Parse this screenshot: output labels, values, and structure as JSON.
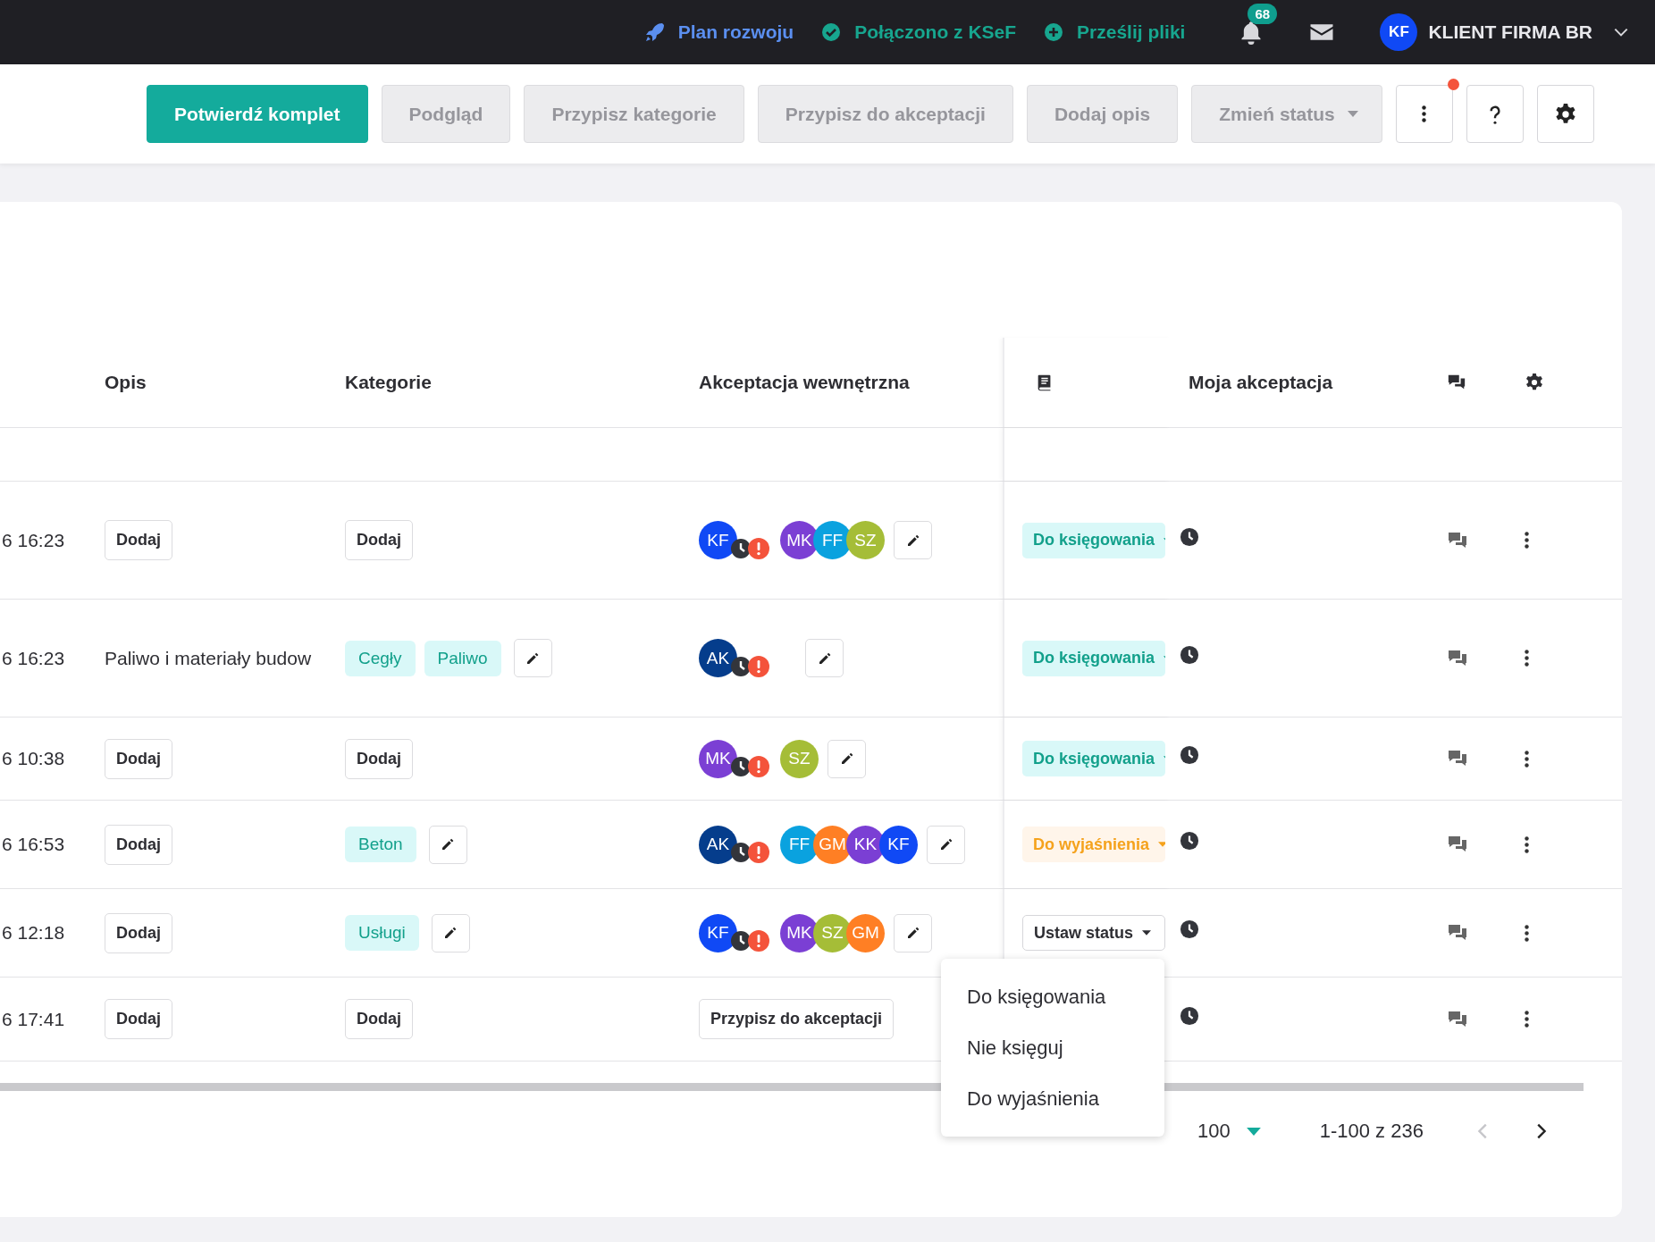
{
  "top_bar": {
    "links": [
      {
        "kind": "roadmap",
        "label": "Plan rozwoju"
      },
      {
        "kind": "connected",
        "label": "Połączono z KSeF"
      },
      {
        "kind": "upload",
        "label": "Prześlij pliki"
      }
    ],
    "notifications_count": "68",
    "user": {
      "initials": "KF",
      "name": "KLIENT FIRMA BR"
    }
  },
  "toolbar": {
    "buttons": [
      {
        "kind": "primary",
        "label": "Potwierdź komplet",
        "disabled": false
      },
      {
        "kind": "plain",
        "label": "Podgląd",
        "disabled": true
      },
      {
        "kind": "plain",
        "label": "Przypisz kategorie",
        "disabled": true
      },
      {
        "kind": "plain",
        "label": "Przypisz do akceptacji",
        "disabled": true
      },
      {
        "kind": "plain",
        "label": "Dodaj opis",
        "disabled": true
      },
      {
        "kind": "dropdown",
        "label": "Zmień status",
        "disabled": true
      }
    ],
    "more_has_alert": true
  },
  "table": {
    "columns": [
      "Opis",
      "Kategorie",
      "Akceptacja wewnętrzna",
      "Moja akceptacja"
    ],
    "rows": [
      {
        "date": "6 16:23",
        "description": {
          "kind": "add",
          "label": "Dodaj"
        },
        "categories": {
          "kind": "add",
          "label": "Dodaj"
        },
        "approval": {
          "kind": "avatars",
          "owner": {
            "initials": "KF",
            "color": "#1049f5"
          },
          "pending": true,
          "others": [
            {
              "initials": "MK",
              "color": "#7b3fd4"
            },
            {
              "initials": "FF",
              "color": "#0aa2df"
            },
            {
              "initials": "SZ",
              "color": "#a5bd37"
            }
          ]
        },
        "status": {
          "kind": "booking",
          "label": "Do księgowania"
        }
      },
      {
        "date": "6 16:23",
        "description": {
          "kind": "text",
          "label": "Paliwo i materiały budow"
        },
        "categories": {
          "kind": "tags",
          "tags": [
            "Cegły",
            "Paliwo"
          ]
        },
        "approval": {
          "kind": "avatars",
          "owner": {
            "initials": "AK",
            "color": "#053d8c"
          },
          "pending": true
        },
        "status": {
          "kind": "booking",
          "label": "Do księgowania"
        }
      },
      {
        "date": "6 10:38",
        "description": {
          "kind": "add",
          "label": "Dodaj"
        },
        "categories": {
          "kind": "add",
          "label": "Dodaj"
        },
        "approval": {
          "kind": "avatars",
          "owner": {
            "initials": "MK",
            "color": "#7b3fd4"
          },
          "pending": true,
          "others": [
            {
              "initials": "SZ",
              "color": "#a5bd37"
            }
          ]
        },
        "status": {
          "kind": "booking",
          "label": "Do księgowania"
        }
      },
      {
        "date": "6 16:53",
        "description": {
          "kind": "add",
          "label": "Dodaj"
        },
        "categories": {
          "kind": "tags",
          "tags": [
            "Beton"
          ]
        },
        "approval": {
          "kind": "avatars",
          "owner": {
            "initials": "AK",
            "color": "#053d8c"
          },
          "pending": true,
          "others": [
            {
              "initials": "FF",
              "color": "#0aa2df"
            },
            {
              "initials": "GM",
              "color": "#ff7f24"
            },
            {
              "initials": "KK",
              "color": "#7b3fd4"
            },
            {
              "initials": "KF",
              "color": "#1049f5"
            }
          ]
        },
        "status": {
          "kind": "clarify",
          "label": "Do wyjaśnienia"
        }
      },
      {
        "date": "6 12:18",
        "description": {
          "kind": "add",
          "label": "Dodaj"
        },
        "categories": {
          "kind": "tags",
          "tags": [
            "Usługi"
          ]
        },
        "approval": {
          "kind": "avatars",
          "owner": {
            "initials": "KF",
            "color": "#1049f5"
          },
          "pending": true,
          "others": [
            {
              "initials": "MK",
              "color": "#7b3fd4"
            },
            {
              "initials": "SZ",
              "color": "#a5bd37"
            },
            {
              "initials": "GM",
              "color": "#ff7f24"
            }
          ]
        },
        "status": {
          "kind": "unset",
          "label": "Ustaw status"
        }
      },
      {
        "date": "6 17:41",
        "description": {
          "kind": "add",
          "label": "Dodaj"
        },
        "categories": {
          "kind": "add",
          "label": "Dodaj"
        },
        "approval": {
          "kind": "assign",
          "label": "Przypisz do akceptacji"
        }
      }
    ]
  },
  "status_menu": {
    "items": [
      "Do księgowania",
      "Nie księguj",
      "Do wyjaśnienia"
    ]
  },
  "pagination": {
    "per_page": "100",
    "range": "1-100 z 236",
    "prev_disabled": true
  }
}
